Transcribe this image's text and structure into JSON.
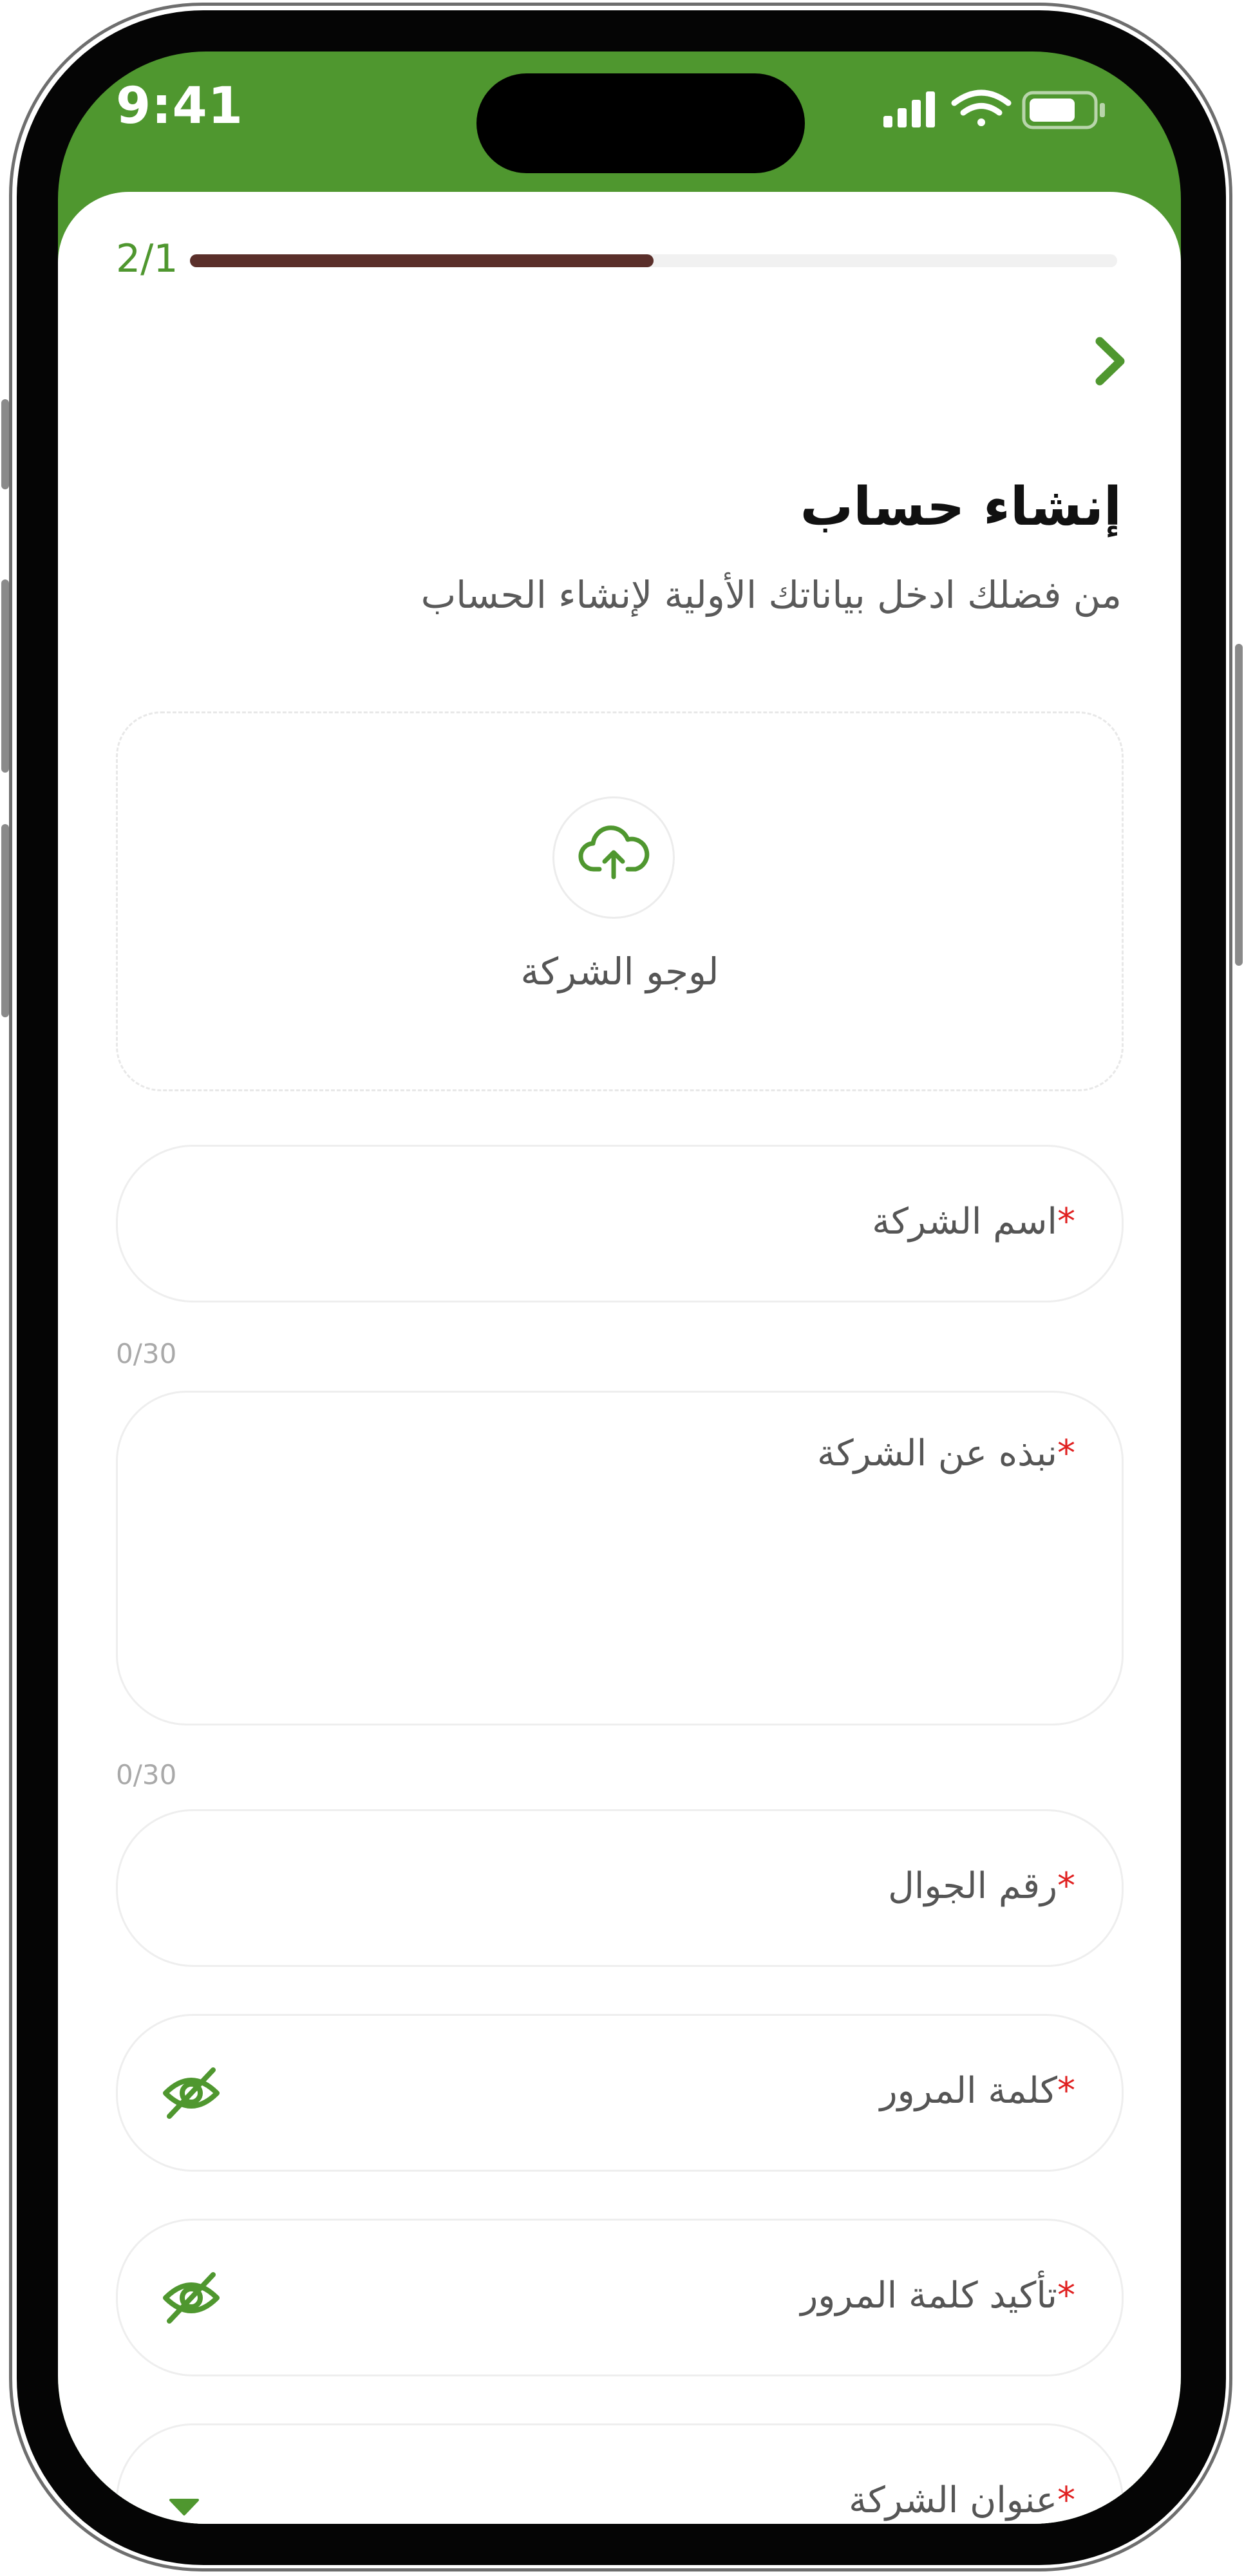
{
  "status_bar": {
    "time": "9:41"
  },
  "progress": {
    "label": "2/1",
    "fraction": 0.5
  },
  "header": {
    "title": "إنشاء حساب",
    "subtitle": "من فضلك ادخل بياناتك الأولية لإنشاء الحساب"
  },
  "logo_upload": {
    "label": "لوجو الشركة"
  },
  "fields": {
    "company_name": {
      "label": "اسم الشركة",
      "required_mark": "*",
      "counter": "0/30"
    },
    "company_about": {
      "label": "نبذه عن  الشركة",
      "required_mark": "*",
      "counter": "0/30"
    },
    "mobile": {
      "label": "رقم الجوال",
      "required_mark": "*"
    },
    "password": {
      "label": "كلمة المرور",
      "required_mark": "*"
    },
    "confirm_password": {
      "label": "تأكيد كلمة المرور",
      "required_mark": "*"
    },
    "company_address": {
      "label": "عنوان الشركة",
      "required_mark": "*"
    }
  },
  "colors": {
    "primary": "#4f972f",
    "progress_fill": "#5a2f2a",
    "required": "#e02020"
  },
  "icons": {
    "back": "chevron-right-icon",
    "upload": "cloud-upload-icon",
    "password_toggle": "eye-off-icon",
    "dropdown": "caret-down-icon"
  }
}
